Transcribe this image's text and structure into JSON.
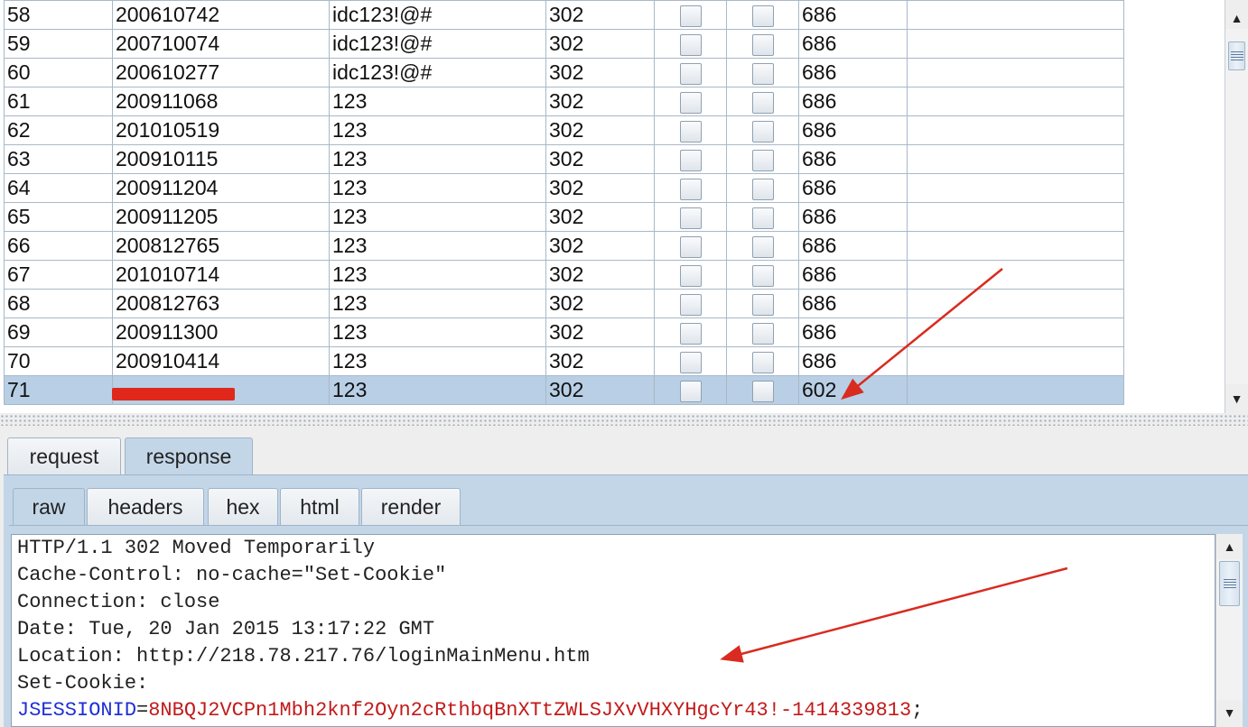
{
  "table": {
    "rows": [
      {
        "num": "58",
        "payload1": "200610742",
        "payload2": "idc123!@#",
        "status": "302",
        "length": "686",
        "selected": false
      },
      {
        "num": "59",
        "payload1": "200710074",
        "payload2": "idc123!@#",
        "status": "302",
        "length": "686",
        "selected": false
      },
      {
        "num": "60",
        "payload1": "200610277",
        "payload2": "idc123!@#",
        "status": "302",
        "length": "686",
        "selected": false
      },
      {
        "num": "61",
        "payload1": "200911068",
        "payload2": "123",
        "status": "302",
        "length": "686",
        "selected": false
      },
      {
        "num": "62",
        "payload1": "201010519",
        "payload2": "123",
        "status": "302",
        "length": "686",
        "selected": false
      },
      {
        "num": "63",
        "payload1": "200910115",
        "payload2": "123",
        "status": "302",
        "length": "686",
        "selected": false
      },
      {
        "num": "64",
        "payload1": "200911204",
        "payload2": "123",
        "status": "302",
        "length": "686",
        "selected": false
      },
      {
        "num": "65",
        "payload1": "200911205",
        "payload2": "123",
        "status": "302",
        "length": "686",
        "selected": false
      },
      {
        "num": "66",
        "payload1": "200812765",
        "payload2": "123",
        "status": "302",
        "length": "686",
        "selected": false
      },
      {
        "num": "67",
        "payload1": "201010714",
        "payload2": "123",
        "status": "302",
        "length": "686",
        "selected": false
      },
      {
        "num": "68",
        "payload1": "200812763",
        "payload2": "123",
        "status": "302",
        "length": "686",
        "selected": false
      },
      {
        "num": "69",
        "payload1": "200911300",
        "payload2": "123",
        "status": "302",
        "length": "686",
        "selected": false
      },
      {
        "num": "70",
        "payload1": "200910414",
        "payload2": "123",
        "status": "302",
        "length": "686",
        "selected": false
      },
      {
        "num": "71",
        "payload1": "",
        "payload2": "123",
        "status": "302",
        "length": "602",
        "selected": true
      }
    ]
  },
  "outer_tabs": [
    {
      "label": "request",
      "active": false
    },
    {
      "label": "response",
      "active": true
    }
  ],
  "inner_tabs": [
    {
      "label": "raw",
      "active": true
    },
    {
      "label": "headers",
      "active": false
    },
    {
      "label": "hex",
      "active": false
    },
    {
      "label": "html",
      "active": false
    },
    {
      "label": "render",
      "active": false
    }
  ],
  "response": {
    "lines": [
      "HTTP/1.1 302 Moved Temporarily",
      "Cache-Control: no-cache=\"Set-Cookie\"",
      "Connection: close",
      "Date: Tue, 20 Jan 2015 13:17:22 GMT",
      "Location: http://218.78.217.76/loginMainMenu.htm",
      "Set-Cookie:"
    ],
    "cookie_name": "JSESSIONID",
    "cookie_eq": "=",
    "cookie_value": "8NBQJ2VCPn1Mbh2knf2Oyn2cRthbqBnXTtZWLSJXvVHXYHgcYr43!-1414339813",
    "cookie_end": ";"
  },
  "colors": {
    "selected_row": "#b8cfe5",
    "active_tab": "#c3d6e8",
    "annotation_arrow": "#d92b1f",
    "cookie_name": "#1f2fd6",
    "cookie_value": "#c21a1a"
  },
  "icons": {
    "scroll_up": "triangle-up-icon",
    "scroll_down": "triangle-down-icon",
    "scroll_grip": "grip-lines-icon"
  }
}
